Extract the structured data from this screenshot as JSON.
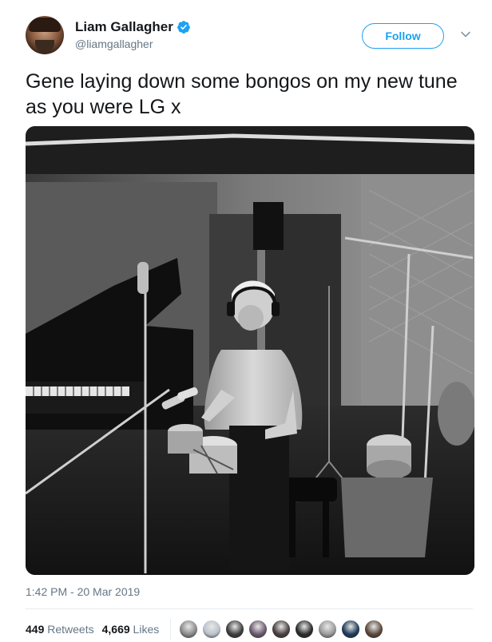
{
  "author": {
    "name": "Liam Gallagher",
    "handle": "@liamgallagher",
    "verified": true,
    "avatar_icon": "user-avatar"
  },
  "follow_label": "Follow",
  "tweet_text": "Gene laying down some bongos on my new tune as you were LG x",
  "media": {
    "type": "photo",
    "tone": "black-and-white"
  },
  "timestamp": "1:42 PM - 20 Mar 2019",
  "stats": {
    "retweets_count": "449",
    "retweets_label": "Retweets",
    "likes_count": "4,669",
    "likes_label": "Likes"
  },
  "likers": [
    {
      "color": "#8a8a8a"
    },
    {
      "color": "#b9c2cc"
    },
    {
      "color": "#3d3d3d"
    },
    {
      "color": "#6b5a6e"
    },
    {
      "color": "#4a4040"
    },
    {
      "color": "#2b2b2b"
    },
    {
      "color": "#9a9a9a"
    },
    {
      "color": "#1f3b5a"
    },
    {
      "color": "#5b4a3a"
    }
  ],
  "colors": {
    "accent": "#1da1f2",
    "text": "#14171a",
    "secondary": "#657786"
  }
}
